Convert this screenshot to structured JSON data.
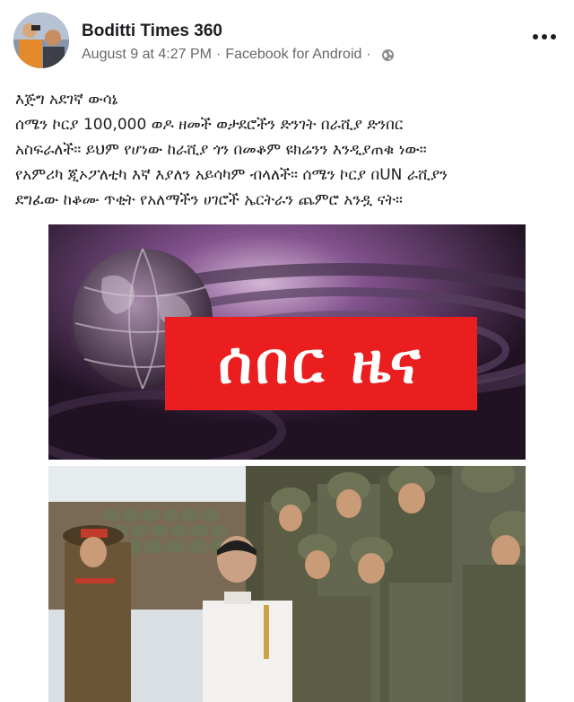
{
  "post": {
    "author": "Boditti Times 360",
    "date": "August 9 at 4:27 PM",
    "separator": "·",
    "source": "Facebook for Android",
    "privacy_icon": "globe-icon",
    "more_icon": "more-options-icon",
    "text_lines": [
      "እጅግ አደገኛ ውሳኔ",
      "ሰሜን ኮርያ 100,000 ወዶ ዘመች ወታደሮችን ድንገት በራሺያ ድንበር",
      "አስፍራለች። ይህም የሆነው ከራሺያ ጎን በመቆም ዩክሬንን እንዲያጠቁ ነው።",
      "የአምሪካ ጂኦፖለቲካ እኛ እያለን አይሳካም ብላለች። ሰሜን ኮርያ በUN ራሺያን",
      "ደግፈው ከቆሙ ጥቂት የአለማችን ሀገሮች ኤርትራን ጨምሮ አንዷ ናት።"
    ]
  },
  "image1": {
    "label": "ሰበር ዜና",
    "colors": {
      "label_bg": "#ea1e1e",
      "label_text": "#ffffff"
    }
  },
  "image2": {
    "colors": {
      "uniform_white": "#f3f1ee",
      "camo": "#5b5e44",
      "helmet": "#6f7356"
    }
  }
}
